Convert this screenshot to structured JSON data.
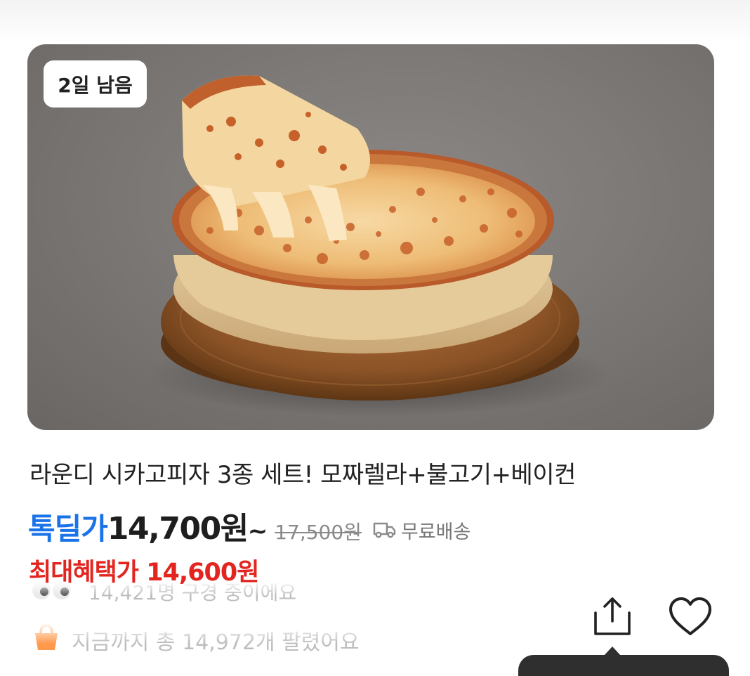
{
  "product": {
    "badge": "2일 남음",
    "title": "라운디 시카고피자 3종 세트! 모짜렐라+불고기+베이컨",
    "deal_label": "톡딜가",
    "deal_price": "14,700원",
    "price_suffix": "~",
    "original_price": "17,500원",
    "shipping": "무료배송",
    "max_benefit_label": "최대혜택가",
    "max_benefit_price": "14,600원",
    "viewers": "14,421명 구경 중이에요",
    "sold": "지금까지 총 14,972개 팔렸어요"
  },
  "icons": {
    "shipping": "truck-icon",
    "viewers": "eyes-icon",
    "sold": "shopping-bag-icon",
    "share": "share-icon",
    "favorite": "heart-icon"
  },
  "colors": {
    "deal_label": "#1a73e8",
    "max_benefit": "#e3251f",
    "price": "#1e1e1e",
    "muted": "#8a8a8a"
  }
}
